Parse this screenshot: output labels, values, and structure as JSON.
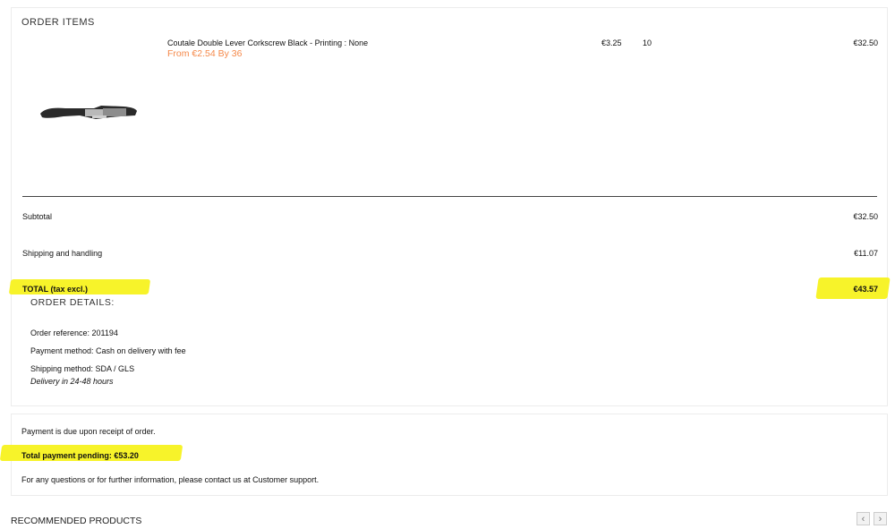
{
  "order_items": {
    "title": "ORDER ITEMS",
    "items": [
      {
        "name": "Coutale Double Lever Corkscrew Black - Printing : None",
        "promo": "From €2.54 By 36",
        "unit_price": "€3.25",
        "quantity": "10",
        "total": "€32.50"
      }
    ],
    "summary": {
      "subtotal_label": "Subtotal",
      "subtotal_value": "€32.50",
      "shipping_label": "Shipping and handling",
      "shipping_value": "€11.07",
      "total_label": "TOTAL (tax excl.)",
      "total_value": "€43.57"
    }
  },
  "order_details": {
    "title": "ORDER DETAILS:",
    "reference": "Order reference: 201194",
    "payment_method": "Payment method: Cash on delivery with fee",
    "shipping_method": "Shipping method: SDA / GLS",
    "delivery_note": "Delivery in 24-48 hours"
  },
  "payment": {
    "due_text": "Payment is due upon receipt of order.",
    "pending_text": "Total payment pending: €53.20",
    "contact_prefix": "For any questions or for further information, please contact us at ",
    "contact_link": "Customer support",
    "contact_suffix": "."
  },
  "recommended": {
    "title": "RECOMMENDED PRODUCTS",
    "prev_icon": "chevron-left-icon",
    "next_icon": "chevron-right-icon"
  },
  "colors": {
    "highlight": "#f7f32a",
    "promo": "#f5894a"
  }
}
